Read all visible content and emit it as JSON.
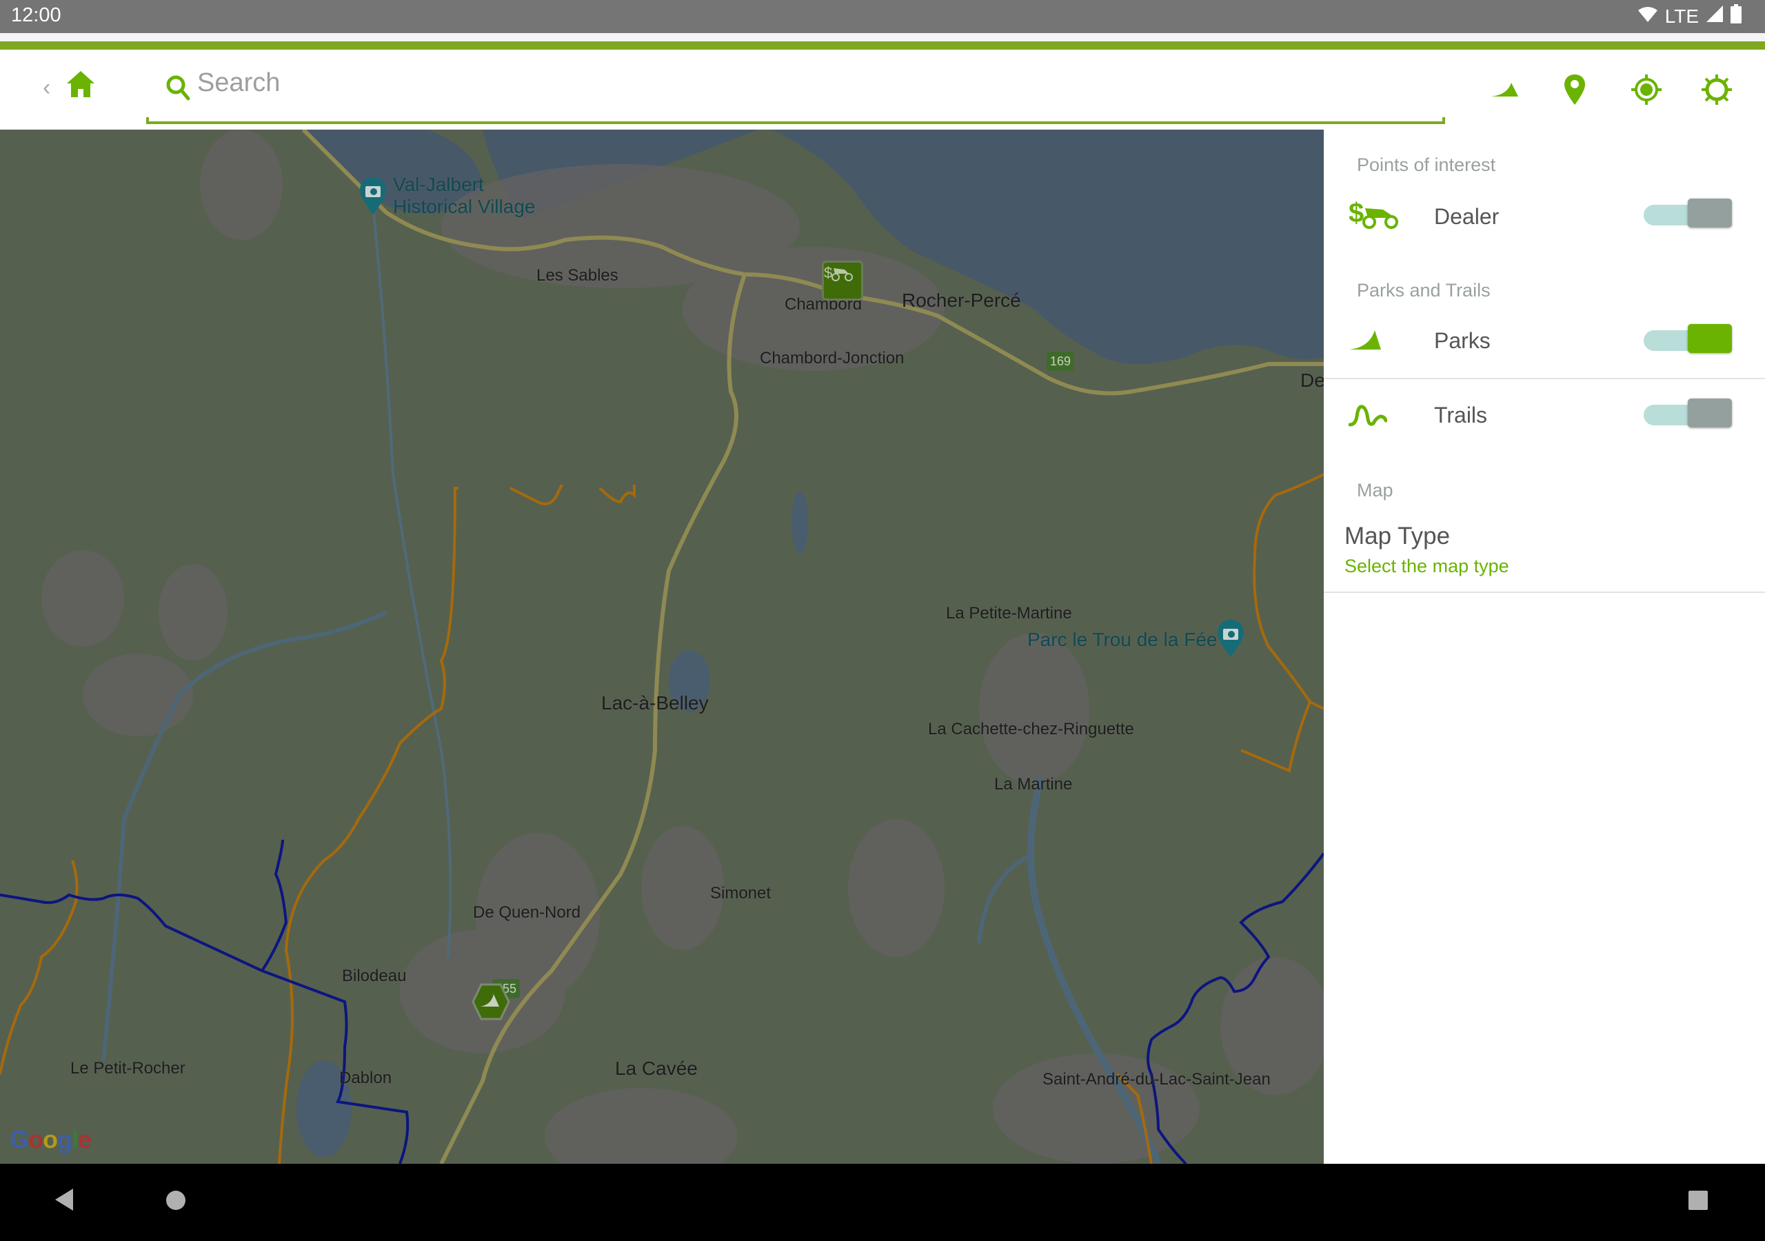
{
  "status_bar": {
    "time": "12:00",
    "network": "LTE",
    "icons": [
      "wifi-icon",
      "signal-icon",
      "battery-icon"
    ]
  },
  "toolbar": {
    "back_icon": "chevron-left-icon",
    "home_icon": "home-icon",
    "search": {
      "placeholder": "Search",
      "value": ""
    },
    "actions": [
      {
        "name": "parks-icon"
      },
      {
        "name": "location-pin-icon"
      },
      {
        "name": "gps-locate-icon"
      },
      {
        "name": "settings-sun-icon"
      }
    ]
  },
  "colors": {
    "brand_green": "#6ab300",
    "bar_green": "#7ea81f",
    "toggle_off_thumb": "#93a09e",
    "toggle_track": "#b9ddd9",
    "trail_blue": "#0c1580",
    "trail_orange": "#a56a0c"
  },
  "map": {
    "attribution": "Google",
    "labels": [
      {
        "text": "Les Sables",
        "type": "place"
      },
      {
        "text": "Chambord",
        "type": "place"
      },
      {
        "text": "Rocher-Percé",
        "type": "place-big"
      },
      {
        "text": "Chambord-Jonction",
        "type": "place"
      },
      {
        "text": "Des",
        "type": "place-big"
      },
      {
        "text": "La Petite-Martine",
        "type": "place"
      },
      {
        "text": "Lac-à-Belley",
        "type": "place-big"
      },
      {
        "text": "La Cachette-chez-Ringuette",
        "type": "place"
      },
      {
        "text": "La Martine",
        "type": "place"
      },
      {
        "text": "Simonet",
        "type": "place"
      },
      {
        "text": "De Quen-Nord",
        "type": "place"
      },
      {
        "text": "Bilodeau",
        "type": "place"
      },
      {
        "text": "Le Petit-Rocher",
        "type": "place"
      },
      {
        "text": "Dablon",
        "type": "place"
      },
      {
        "text": "La Cavée",
        "type": "place-big"
      },
      {
        "text": "Saint-André-du-Lac-Saint-Jean",
        "type": "place"
      }
    ],
    "pois": [
      {
        "text": "Val-Jalbert\nHistorical Village",
        "icon": "camera-pin-icon"
      },
      {
        "text": "Parc le Trou de la Fée",
        "icon": "camera-pin-icon"
      }
    ],
    "route_shields": [
      "169",
      "155"
    ],
    "markers": [
      {
        "type": "dealer",
        "icon": "dealer-motorcycle-icon"
      },
      {
        "type": "park",
        "icon": "park-hexagon-icon"
      }
    ]
  },
  "panel": {
    "sections": [
      {
        "title": "Points of interest",
        "items": [
          {
            "label": "Dealer",
            "icon": "dealer-motorcycle-icon",
            "enabled": false
          }
        ]
      },
      {
        "title": "Parks and Trails",
        "items": [
          {
            "label": "Parks",
            "icon": "parks-icon",
            "enabled": true
          },
          {
            "label": "Trails",
            "icon": "trails-icon",
            "enabled": false
          }
        ]
      },
      {
        "title": "Map",
        "items": [
          {
            "label": "Map Type",
            "sublabel": "Select the map type"
          }
        ]
      }
    ]
  },
  "nav_bar": {
    "buttons": [
      "back-nav-icon",
      "home-nav-icon",
      "recents-nav-icon"
    ]
  }
}
